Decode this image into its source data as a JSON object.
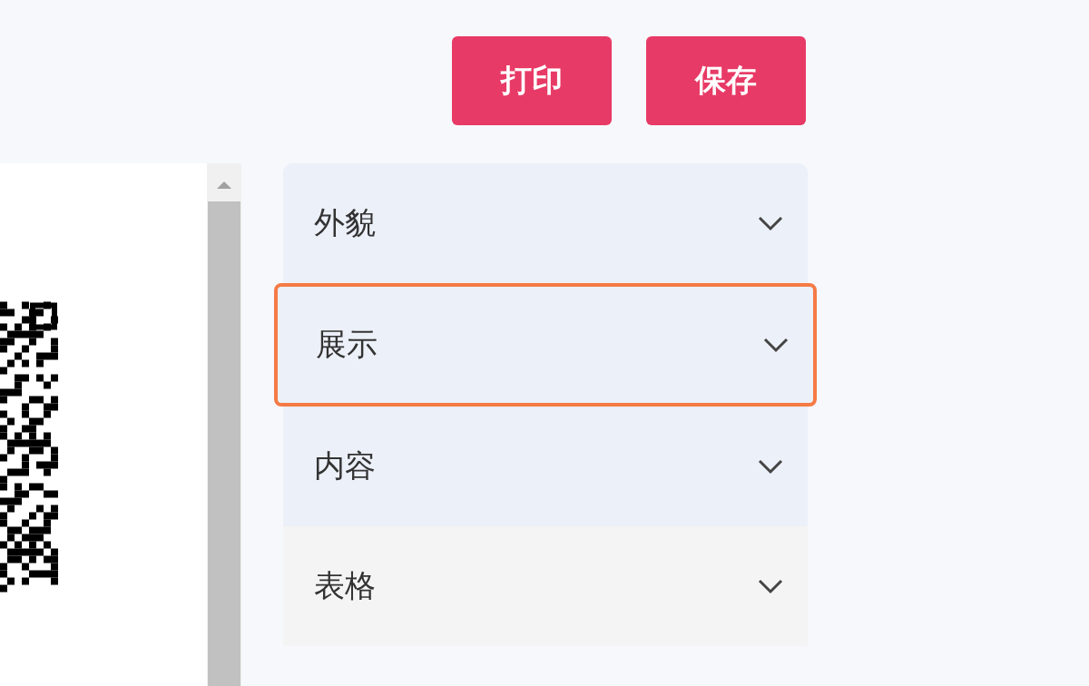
{
  "toolbar": {
    "buttons": [
      "打印",
      "保存"
    ]
  },
  "settings_panel": {
    "sections": [
      {
        "label": "外貌",
        "selected": false,
        "kind": "section"
      },
      {
        "label": "展示",
        "selected": true,
        "kind": "section"
      },
      {
        "label": "内容",
        "selected": false,
        "kind": "section"
      },
      {
        "label": "表格",
        "selected": false,
        "kind": "muted"
      }
    ]
  }
}
